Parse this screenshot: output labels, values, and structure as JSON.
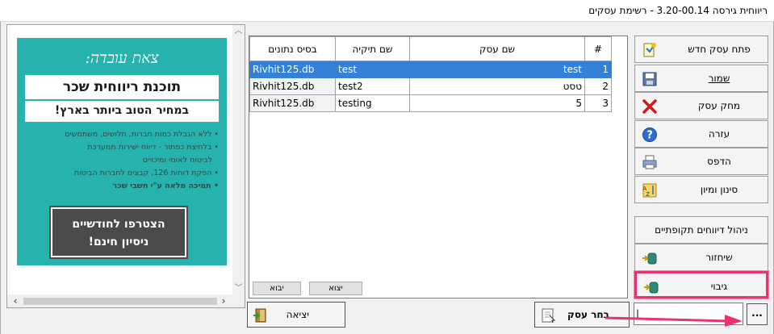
{
  "window": {
    "title": "ריווחית גירסה 3.20-00.14 - רשימת עסקים"
  },
  "ad": {
    "script_title": "צאת עובדה:",
    "headline": "תוכנת ריווחית שכר",
    "subline": "במחיר הטוב ביותר בארץ!",
    "bullets": [
      "ללא הגבלת כמות חברות, תלושים, משתמשים",
      "בלחיצת כפתור - דיווח ישירות ממערכת",
      "לביטוח לאומי ומיכויים",
      "הפקת דוחות 126, קבצים לחברות הביטוח",
      "תמיכה מלאה ע\"י חשבי שכר"
    ],
    "cta_line1": "הצטרפו לחודשיים",
    "cta_line2": "ניסיון חינם!"
  },
  "grid": {
    "columns": [
      "#",
      "שם עסק",
      "שם תיקיה",
      "בסיס נתונים"
    ],
    "rows": [
      {
        "num": "1",
        "name": "test",
        "folder": "test",
        "db": "Rivhit125.db"
      },
      {
        "num": "2",
        "name": "טסט",
        "folder": "test2",
        "db": "Rivhit125.db"
      },
      {
        "num": "3",
        "name": "5",
        "folder": "testing",
        "db": "Rivhit125.db"
      }
    ],
    "import_label": "יבוא",
    "export_label": "יצוא"
  },
  "actions": {
    "open_new": "פתח עסק חדש",
    "save": "שמור",
    "delete": "מחק עסק",
    "help": "עזרה",
    "print": "הדפס",
    "filter_sort": "סינון ומיון",
    "periodic_reports": "ניהול דיווחים תקופתיים",
    "restore": "שיחזור",
    "backup": "גיבוי",
    "select_business": "בחר עסק",
    "exit": "יציאה",
    "browse": "...",
    "path_value": "|"
  },
  "colors": {
    "selection": "#3380d6",
    "ad_bg": "#26b3ad",
    "highlight": "#e8336f"
  }
}
